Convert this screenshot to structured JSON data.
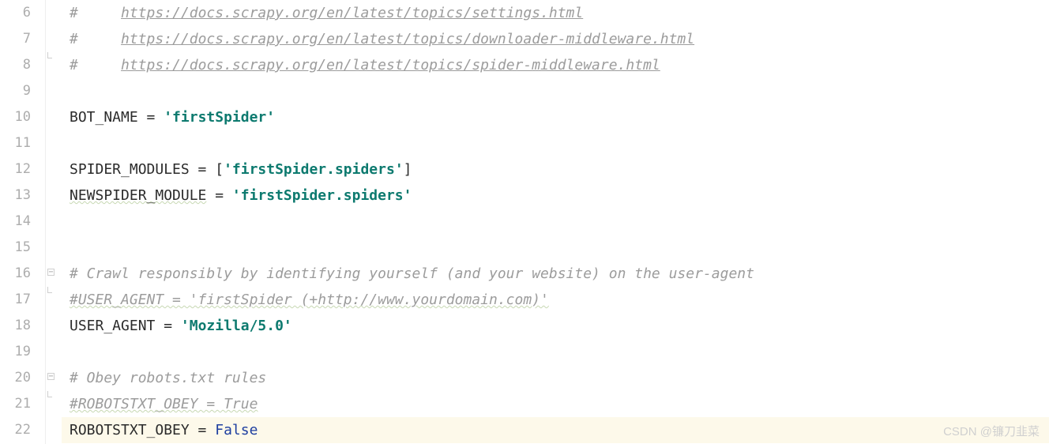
{
  "editor": {
    "first_line_number": 6,
    "current_line": 22,
    "lines": [
      {
        "n": 6,
        "fold": "",
        "segments": [
          {
            "cls": "comment",
            "t": "#     "
          },
          {
            "cls": "comment comment-link",
            "t": "https://docs.scrapy.org/en/latest/topics/settings.html"
          }
        ]
      },
      {
        "n": 7,
        "fold": "",
        "segments": [
          {
            "cls": "comment",
            "t": "#     "
          },
          {
            "cls": "comment comment-link",
            "t": "https://docs.scrapy.org/en/latest/topics/downloader-middleware.html"
          }
        ]
      },
      {
        "n": 8,
        "fold": "end",
        "segments": [
          {
            "cls": "comment",
            "t": "#     "
          },
          {
            "cls": "comment comment-link",
            "t": "https://docs.scrapy.org/en/latest/topics/spider-middleware.html"
          }
        ]
      },
      {
        "n": 9,
        "fold": "",
        "segments": []
      },
      {
        "n": 10,
        "fold": "",
        "segments": [
          {
            "cls": "var",
            "t": "BOT_NAME"
          },
          {
            "cls": "op",
            "t": " = "
          },
          {
            "cls": "str",
            "t": "'firstSpider'"
          }
        ]
      },
      {
        "n": 11,
        "fold": "",
        "segments": []
      },
      {
        "n": 12,
        "fold": "",
        "segments": [
          {
            "cls": "var",
            "t": "SPIDER_MODULES"
          },
          {
            "cls": "op",
            "t": " = "
          },
          {
            "cls": "brkt",
            "t": "["
          },
          {
            "cls": "str",
            "t": "'firstSpider.spiders'"
          },
          {
            "cls": "brkt",
            "t": "]"
          }
        ]
      },
      {
        "n": 13,
        "fold": "",
        "segments": [
          {
            "cls": "var squiggle",
            "t": "NEWSPIDER_MODULE"
          },
          {
            "cls": "op",
            "t": " = "
          },
          {
            "cls": "str",
            "t": "'firstSpider.spiders'"
          }
        ]
      },
      {
        "n": 14,
        "fold": "",
        "segments": []
      },
      {
        "n": 15,
        "fold": "",
        "segments": []
      },
      {
        "n": 16,
        "fold": "start",
        "segments": [
          {
            "cls": "comment",
            "t": "# Crawl responsibly by identifying yourself (and your website) on the user-agent"
          }
        ]
      },
      {
        "n": 17,
        "fold": "end",
        "segments": [
          {
            "cls": "comment squig-line",
            "t": "#USER_AGENT = 'firstSpider (+http://www.yourdomain.com)'"
          }
        ]
      },
      {
        "n": 18,
        "fold": "",
        "segments": [
          {
            "cls": "var",
            "t": "USER_AGENT"
          },
          {
            "cls": "op",
            "t": " = "
          },
          {
            "cls": "str",
            "t": "'Mozilla/5.0'"
          }
        ]
      },
      {
        "n": 19,
        "fold": "",
        "segments": []
      },
      {
        "n": 20,
        "fold": "start",
        "segments": [
          {
            "cls": "comment",
            "t": "# Obey robots.txt rules"
          }
        ]
      },
      {
        "n": 21,
        "fold": "end",
        "segments": [
          {
            "cls": "comment squig-line",
            "t": "#ROBOTSTXT_OBEY = True"
          }
        ]
      },
      {
        "n": 22,
        "fold": "",
        "segments": [
          {
            "cls": "var",
            "t": "ROBOTSTXT_OBEY"
          },
          {
            "cls": "op",
            "t": " = "
          },
          {
            "cls": "kw",
            "t": "False"
          }
        ]
      }
    ]
  },
  "watermark": "CSDN @镰刀韭菜"
}
